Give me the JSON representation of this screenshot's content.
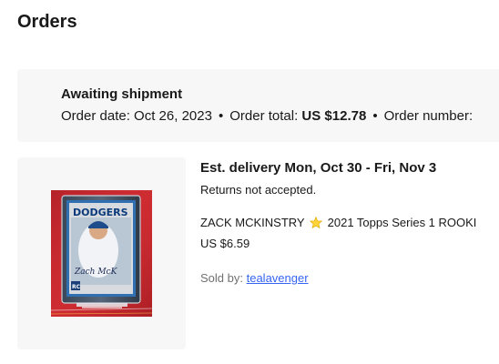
{
  "page": {
    "title": "Orders"
  },
  "status_banner": {
    "status": "Awaiting shipment",
    "order_date_label": "Order date:",
    "order_date": "Oct 26, 2023",
    "separator": "•",
    "order_total_label": "Order total:",
    "order_total": "US $12.78",
    "order_number_label": "Order number:"
  },
  "item": {
    "delivery": "Est. delivery Mon, Oct 30 - Fri, Nov 3",
    "returns": "Returns not accepted.",
    "title_part1": "ZACK MCKINSTRY",
    "title_icon": "star-icon",
    "title_part2": "2021 Topps Series 1 ROOKI",
    "price": "US $6.59",
    "sold_by_label": "Sold by:",
    "seller": "tealavenger",
    "image": {
      "card_team_text": "DODGERS",
      "signature_text": "Zach McK",
      "rc_badge": "RC"
    }
  },
  "colors": {
    "banner_bg": "#f7f7f7",
    "link": "#3665f3",
    "text": "#191919",
    "muted_text": "#707070"
  }
}
